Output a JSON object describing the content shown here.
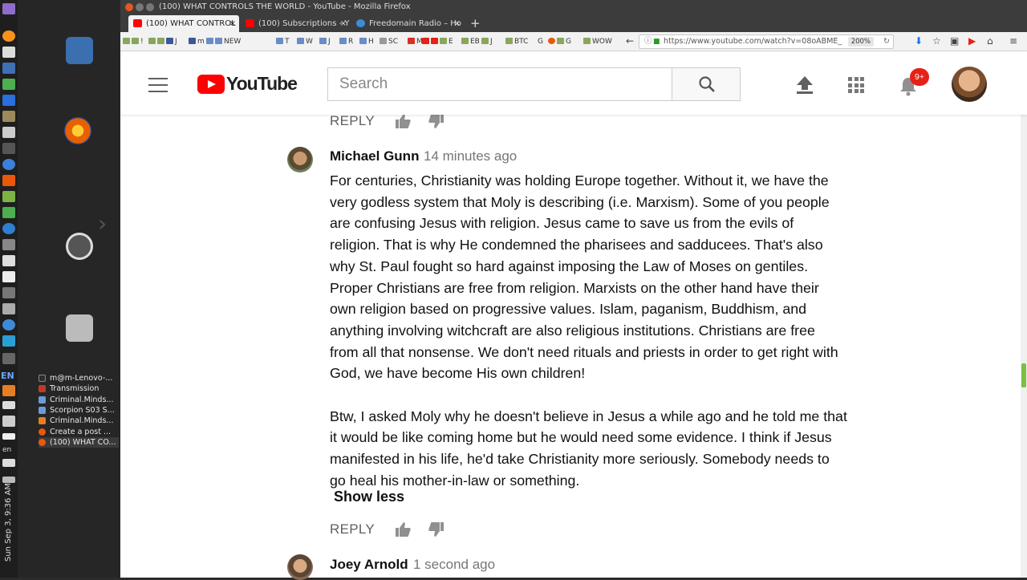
{
  "window": {
    "title": "(100) WHAT CONTROLS THE WORLD - YouTube - Mozilla Firefox"
  },
  "system": {
    "clock": "Sun Sep 3, 9:36 AM",
    "lang_top": "EN",
    "lang_bottom": "en"
  },
  "tasks": [
    {
      "label": "m@m-Lenovo-...",
      "color": "#2d2d2d"
    },
    {
      "label": "Transmission",
      "color": "#c0392b"
    },
    {
      "label": "Criminal.Minds...",
      "color": "#6a9bd8"
    },
    {
      "label": "Scorpion S03 S...",
      "color": "#6a9bd8"
    },
    {
      "label": "Criminal.Minds...",
      "color": "#e67e22"
    },
    {
      "label": "Create a post ...",
      "color": "#e8590c"
    },
    {
      "label": "(100) WHAT CO...",
      "color": "#e8590c"
    }
  ],
  "tabs": [
    {
      "label": "(100) WHAT CONTROL",
      "close": "×"
    },
    {
      "label": "(100) Subscriptions - Y",
      "close": "×"
    },
    {
      "label": "Freedomain Radio – Ho",
      "close": "×"
    }
  ],
  "newtab": "+",
  "bookmarks": [
    "!",
    "J",
    "m",
    "NEW",
    "T",
    "W",
    "J",
    "R",
    "H",
    "SC",
    "M",
    "E",
    "EB",
    "J",
    "BTC",
    "G",
    "G",
    "WOW"
  ],
  "url": {
    "text": "https://www.youtube.com/watch?v=08oABME_",
    "zoom": "200%"
  },
  "youtube": {
    "logo_text": "YouTube",
    "search_placeholder": "Search",
    "notifications": "9+"
  },
  "comments": {
    "reply_label": "REPLY",
    "show_less": "Show less",
    "items": [
      {
        "author": "Michael Gunn",
        "time": "14 minutes ago",
        "body": "For centuries, Christianity was holding Europe together. Without it, we have the\nvery godless system that Moly is describing (i.e. Marxism). Some of you people\nare confusing Jesus with religion. Jesus came to save us from the evils of\nreligion. That is why He condemned the pharisees and sadducees. That's also\nwhy St. Paul fought so hard against imposing the Law of Moses on gentiles.\nProper Christians are free from religion. Marxists on the other hand have their\nown religion based on progressive values. Islam, paganism, Buddhism, and\nanything involving witchcraft are also religious institutions. Christians are free\nfrom all that nonsense. We don't need rituals and priests in order to get right with\nGod, we have become His own children!\n\nBtw, I asked Moly why he doesn't believe in Jesus a while ago and he told me that\nit would be like coming home but he would need some evidence. I think if Jesus\nmanifested in his life, he'd take Christianity more seriously. Somebody needs to\ngo heal his mother-in-law or something."
      },
      {
        "author": "Joey Arnold",
        "time": "1 second ago"
      }
    ]
  },
  "colors": {
    "youtube_red": "#ff0000",
    "badge_red": "#e62117",
    "meta_gray": "#767676"
  }
}
